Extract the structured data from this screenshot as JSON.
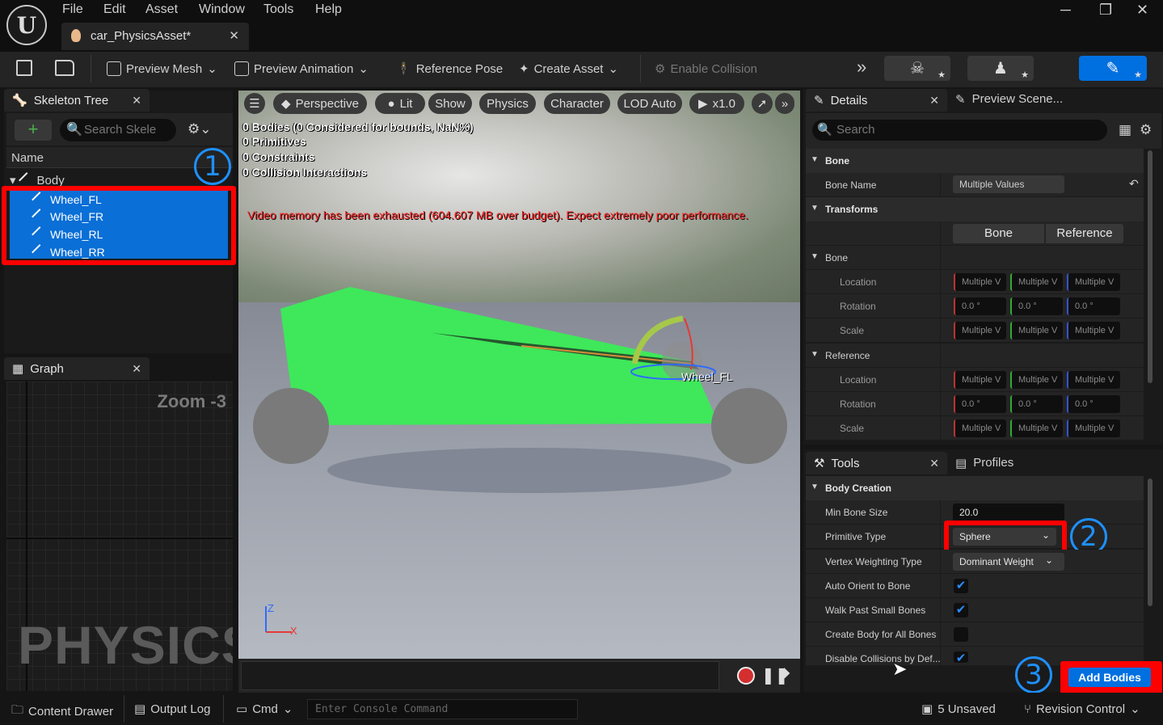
{
  "menu": [
    "File",
    "Edit",
    "Asset",
    "Window",
    "Tools",
    "Help"
  ],
  "document_tab": "car_PhysicsAsset*",
  "toolbar": {
    "preview_mesh": "Preview Mesh",
    "preview_animation": "Preview Animation",
    "reference_pose": "Reference Pose",
    "create_asset": "Create Asset",
    "enable_collision": "Enable Collision"
  },
  "skeleton_tree": {
    "title": "Skeleton Tree",
    "search_placeholder": "Search Skele",
    "column": "Name",
    "root": "Body",
    "bones": [
      "Wheel_FL",
      "Wheel_FR",
      "Wheel_RL",
      "Wheel_RR"
    ]
  },
  "graph": {
    "title": "Graph",
    "zoom": "Zoom -3",
    "watermark": "PHYSICS"
  },
  "viewport": {
    "pills": [
      "Perspective",
      "Lit",
      "Show",
      "Physics",
      "Character",
      "LOD Auto",
      "x1.0"
    ],
    "stats": [
      "0 Bodies (0 Considered for bounds, NaN%)",
      "0 Primitives",
      "0 Constraints",
      "0 Collision Interactions"
    ],
    "warning": "Video memory has been exhausted (604.607 MB over budget). Expect extremely poor performance.",
    "bone_label": "Wheel_FL",
    "axis_z": "Z",
    "axis_x": "X"
  },
  "details": {
    "title": "Details",
    "preview_tab": "Preview Scene...",
    "search_placeholder": "Search",
    "cat_bone": "Bone",
    "bone_name_label": "Bone Name",
    "bone_name_value": "Multiple Values",
    "cat_transforms": "Transforms",
    "seg_bone": "Bone",
    "seg_reference": "Reference",
    "sub_bone": "Bone",
    "sub_reference": "Reference",
    "location": "Location",
    "rotation": "Rotation",
    "scale": "Scale",
    "multi": "Multiple V",
    "zero": "0.0 °"
  },
  "tools": {
    "title": "Tools",
    "profiles": "Profiles",
    "category": "Body Creation",
    "min_bone_size_label": "Min Bone Size",
    "min_bone_size": "20.0",
    "primitive_type_label": "Primitive Type",
    "primitive_type": "Sphere",
    "vertex_weighting_label": "Vertex Weighting Type",
    "vertex_weighting": "Dominant Weight",
    "auto_orient_label": "Auto Orient to Bone",
    "walk_past_label": "Walk Past Small Bones",
    "create_all_label": "Create Body for All Bones",
    "disable_collisions_label": "Disable Collisions by Def...",
    "add_bodies": "Add Bodies"
  },
  "annotations": [
    "1",
    "2",
    "3"
  ],
  "statusbar": {
    "content_drawer": "Content Drawer",
    "output_log": "Output Log",
    "cmd": "Cmd",
    "console_placeholder": "Enter Console Command",
    "unsaved": "5 Unsaved",
    "revision_control": "Revision Control"
  },
  "colors": {
    "accent": "#0070e0",
    "highlight": "#ff0000",
    "annotation": "#1e90ff",
    "selection": "#0a6fd6"
  }
}
